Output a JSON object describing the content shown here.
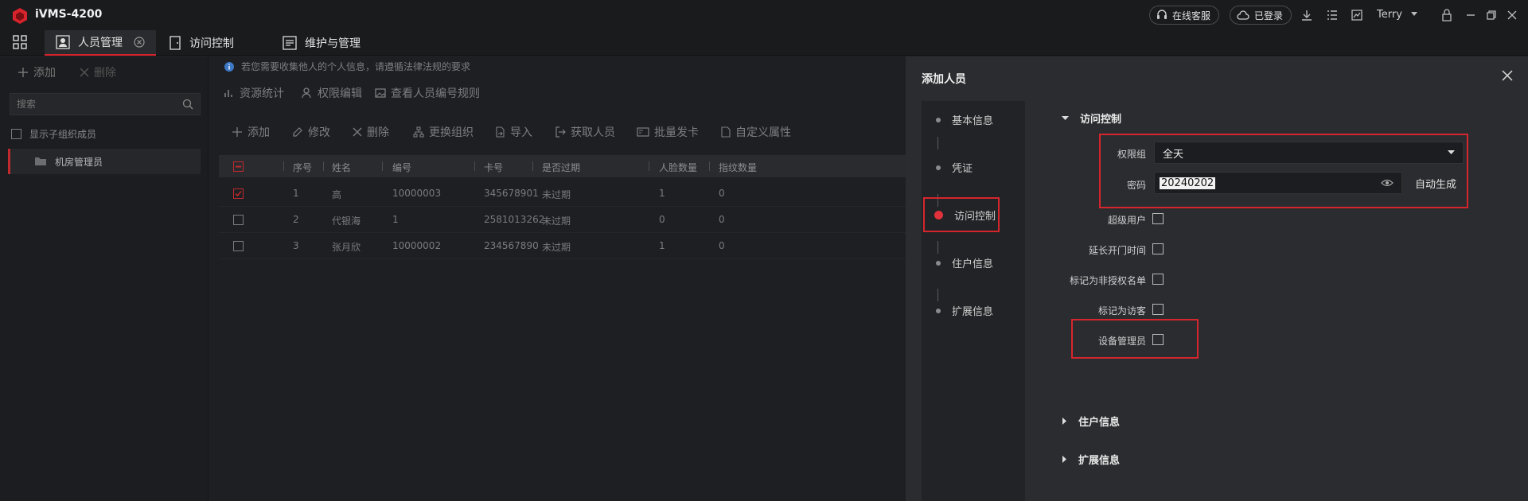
{
  "app": {
    "title": "iVMS-4200"
  },
  "titlebar": {
    "online_service": "在线客服",
    "logged_in": "已登录",
    "username": "Terry"
  },
  "tabs": [
    {
      "label": "人员管理",
      "active": true
    },
    {
      "label": "访问控制",
      "active": false
    },
    {
      "label": "维护与管理",
      "active": false
    }
  ],
  "left_panel": {
    "add_label": "添加",
    "delete_label": "删除",
    "search_placeholder": "搜索",
    "show_sub_org": "显示子组织成员",
    "org_item": "机房管理员"
  },
  "main": {
    "notice": "若您需要收集他人的个人信息，请遵循法律法规的要求",
    "subnav": [
      "资源统计",
      "权限编辑",
      "查看人员编号规则"
    ],
    "toolbar": [
      "添加",
      "修改",
      "删除",
      "更换组织",
      "导入",
      "获取人员",
      "批量发卡",
      "自定义属性"
    ],
    "columns": [
      "序号",
      "姓名",
      "编号",
      "卡号",
      "是否过期",
      "人脸数量",
      "指纹数量"
    ],
    "rows": [
      {
        "index": "1",
        "name": "高",
        "id": "10000003",
        "card": "345678901",
        "expired": "未过期",
        "faces": "1",
        "fingerprints": "0",
        "checked": true
      },
      {
        "index": "2",
        "name": "代银海",
        "id": "1",
        "card": "2581013262",
        "expired": "未过期",
        "faces": "0",
        "fingerprints": "0",
        "checked": false
      },
      {
        "index": "3",
        "name": "张月欣",
        "id": "10000002",
        "card": "234567890",
        "expired": "未过期",
        "faces": "1",
        "fingerprints": "0",
        "checked": false
      }
    ]
  },
  "dialog": {
    "title": "添加人员",
    "steps": [
      "基本信息",
      "凭证",
      "访问控制",
      "住户信息",
      "扩展信息"
    ],
    "active_step": "访问控制",
    "section_access": "访问控制",
    "permission_group_label": "权限组",
    "permission_group_value": "全天",
    "password_label": "密码",
    "password_value": "20240202",
    "auto_generate": "自动生成",
    "super_user": "超级用户",
    "extend_open_time": "延长开门时间",
    "mark_blocklist": "标记为非授权名单",
    "mark_visitor": "标记为访客",
    "device_admin": "设备管理员",
    "section_resident": "住户信息",
    "section_extended": "扩展信息"
  },
  "colors": {
    "accent": "#d7232c",
    "bg": "#202124",
    "dialog": "#2b2c2f"
  }
}
